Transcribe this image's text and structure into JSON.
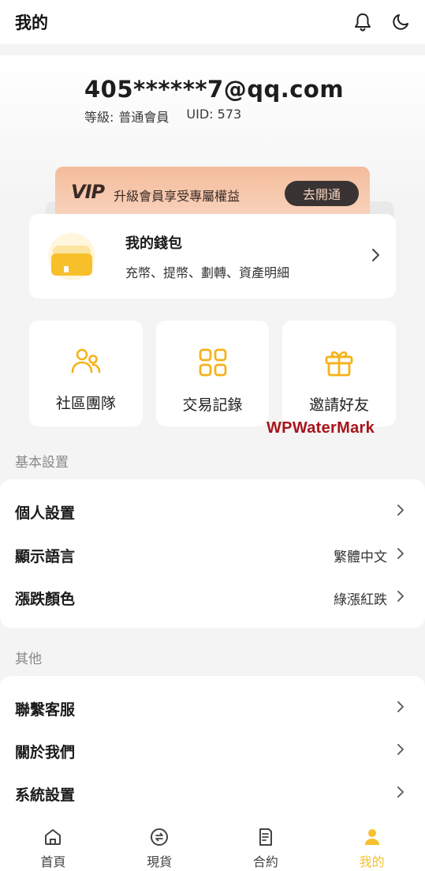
{
  "header": {
    "title": "我的"
  },
  "profile": {
    "email": "405******7@qq.com",
    "level_label": "等級:",
    "level_value": "普通會員",
    "uid": "UID: 573"
  },
  "vip": {
    "logo": "VIP",
    "text": "升級會員享受專屬權益",
    "button": "去開通"
  },
  "wallet": {
    "title": "我的錢包",
    "subtitle": "充幣、提幣、劃轉、資產明細"
  },
  "quick_actions": [
    {
      "label": "社區團隊",
      "icon": "team-icon"
    },
    {
      "label": "交易記錄",
      "icon": "grid-icon"
    },
    {
      "label": "邀請好友",
      "icon": "gift-icon"
    }
  ],
  "watermark": "WPWaterMark",
  "basic_settings": {
    "title": "基本設置",
    "items": [
      {
        "label": "個人設置",
        "value": ""
      },
      {
        "label": "顯示語言",
        "value": "繁體中文"
      },
      {
        "label": "漲跌顏色",
        "value": "綠漲紅跌"
      }
    ]
  },
  "other": {
    "title": "其他",
    "items": [
      {
        "label": "聯繫客服"
      },
      {
        "label": "關於我們"
      },
      {
        "label": "系統設置"
      }
    ]
  },
  "tabbar": {
    "tabs": [
      {
        "label": "首頁",
        "icon": "home-icon"
      },
      {
        "label": "現貨",
        "icon": "spot-icon"
      },
      {
        "label": "合約",
        "icon": "contract-icon"
      },
      {
        "label": "我的",
        "icon": "user-icon",
        "active": true
      }
    ]
  },
  "colors": {
    "accent": "#f5c12e",
    "vip_btn": "#3a3333",
    "watermark": "#a8141b"
  }
}
